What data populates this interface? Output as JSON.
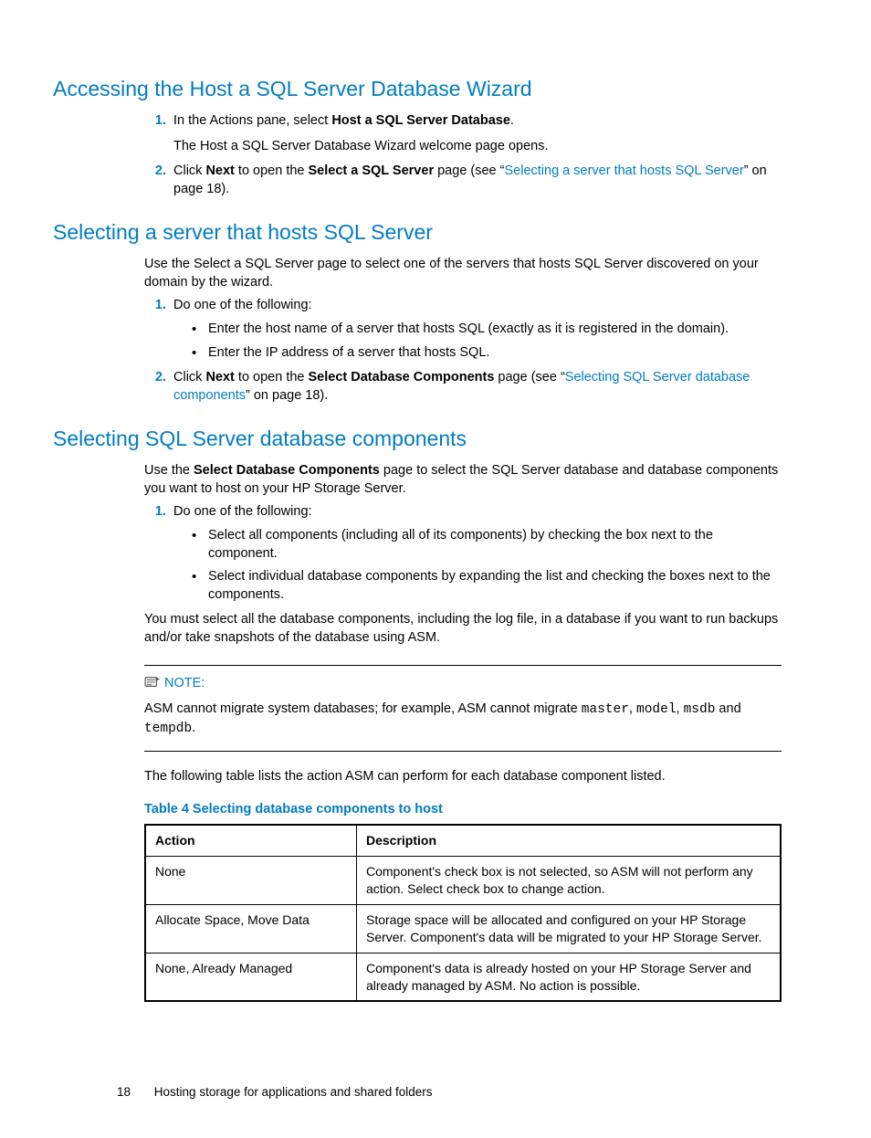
{
  "sections": {
    "s1": {
      "title": "Accessing the Host a SQL Server Database Wizard",
      "step1_a": "In the Actions pane, select ",
      "step1_b": "Host a SQL Server Database",
      "step1_c": ".",
      "step1_sub": "The Host a SQL Server Database Wizard welcome page opens.",
      "step2_a": "Click ",
      "step2_b": "Next",
      "step2_c": " to open the ",
      "step2_d": "Select a SQL Server",
      "step2_e": " page (see “",
      "step2_link": "Selecting a server that hosts SQL Server",
      "step2_f": "” on page 18)."
    },
    "s2": {
      "title": "Selecting a server that hosts SQL Server",
      "intro": "Use the Select a SQL Server page to select one of the servers that hosts SQL Server discovered on your domain by the wizard.",
      "step1": "Do one of the following:",
      "bul1": "Enter the host name of a server that hosts SQL (exactly as it is registered in the domain).",
      "bul2": "Enter the IP address of a server that hosts SQL.",
      "step2_a": "Click ",
      "step2_b": "Next",
      "step2_c": " to open the ",
      "step2_d": "Select Database Components",
      "step2_e": " page (see “",
      "step2_link": "Selecting SQL Server database components",
      "step2_f": "” on page 18)."
    },
    "s3": {
      "title": "Selecting SQL Server database components",
      "intro_a": "Use the ",
      "intro_b": "Select Database Components",
      "intro_c": " page to select the SQL Server database and database components you want to host on your HP Storage Server.",
      "step1": "Do one of the following:",
      "bul1": "Select all components (including all of its components) by checking the box next to the component.",
      "bul2": "Select individual database components by expanding the list and checking the boxes next to the components.",
      "para2": "You must select all the database components, including the log file, in a database if you want to run backups and/or take snapshots of the database using ASM.",
      "note_label": "NOTE:",
      "note_a": "ASM cannot migrate system databases; for example, ASM cannot migrate ",
      "note_m1": "master",
      "note_m2": "model",
      "note_m3": "msdb",
      "note_and": " and ",
      "note_m4": "tempdb",
      "note_dot": ".",
      "note_comma": ", ",
      "para3": "The following table lists the action ASM can perform for each database component listed.",
      "tablecap": "Table 4 Selecting database components to host",
      "th1": "Action",
      "th2": "Description",
      "rows": [
        {
          "a": "None",
          "d": "Component's check box is not selected, so ASM will not perform any action. Select check box to change action."
        },
        {
          "a": "Allocate Space, Move Data",
          "d": "Storage space will be allocated and configured on your HP Storage Server. Component's data will be migrated to your HP Storage Server."
        },
        {
          "a": "None, Already Managed",
          "d": "Component's data is already hosted on your HP Storage Server and already managed by ASM. No action is possible."
        }
      ]
    }
  },
  "nums": {
    "n1": "1.",
    "n2": "2."
  },
  "footer": {
    "page": "18",
    "title": "Hosting storage for applications and shared folders"
  }
}
